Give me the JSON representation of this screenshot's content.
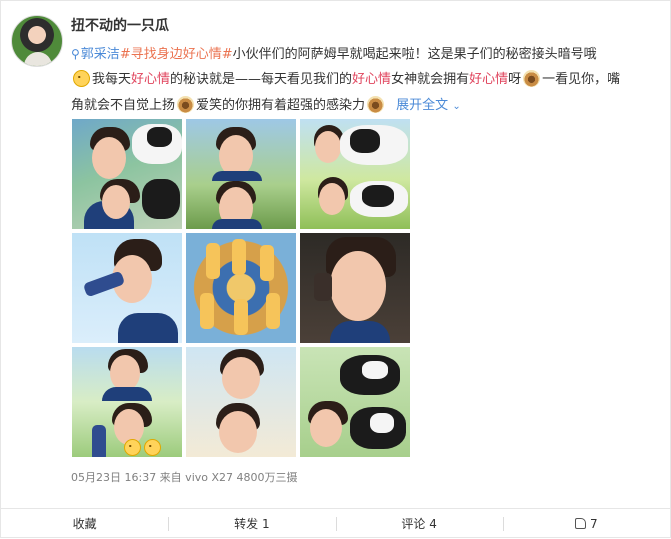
{
  "post": {
    "username": "扭不动的一只瓜",
    "mention": "郭采洁",
    "hashtag": "#寻找身边好心情#",
    "line1_rest": "小伙伴们的阿萨姆早就喝起来啦！这是果子们的秘密接头暗号哦",
    "line2_a": "我每天",
    "kw": "好心情",
    "line2_b": "的秘诀就是——每天看见我们的",
    "line2_c": "女神就会拥有",
    "line2_d": "呀",
    "line2_e": "一看见你，嘴",
    "line3_a": "角就会不自觉上扬",
    "line3_b": "爱笑的你拥有着超强的感染力",
    "expand": "展开全文",
    "meta": "05月23日 16:37 来自 vivo X27 4800万三摄"
  },
  "actions": {
    "favorite": "收藏",
    "repost": "转发 1",
    "comment": "评论 4",
    "like": "7"
  },
  "icons": {
    "mention": "location-pin-icon",
    "thinking": "thinking-face-emoji",
    "cow": "cow-emoji",
    "chevron": "chevron-down-icon",
    "like": "thumbs-up-icon"
  },
  "colors": {
    "link_blue": "#4b8ad7",
    "hashtag_orange": "#eb7350",
    "keyword_red": "#e0445d"
  }
}
